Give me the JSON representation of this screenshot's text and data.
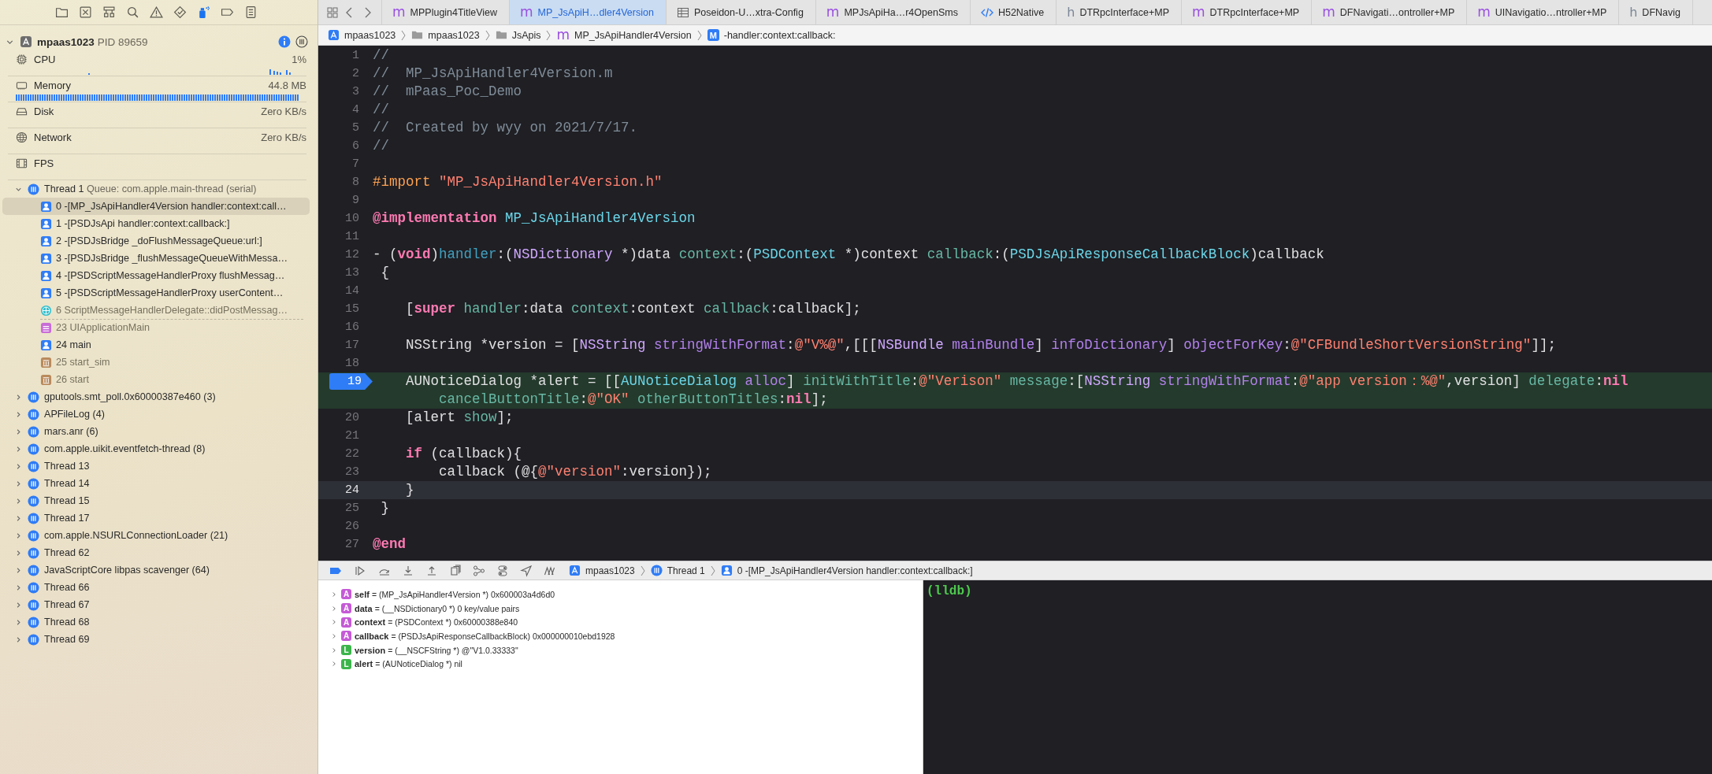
{
  "navigator": [
    {
      "selected": false
    },
    {
      "selected": false
    },
    {
      "selected": false
    },
    {
      "selected": false
    },
    {
      "selected": false
    },
    {
      "selected": false
    },
    {
      "selected": true
    },
    {
      "selected": false
    },
    {
      "selected": false
    }
  ],
  "process": {
    "name": "mpaas1023",
    "pid": "PID 89659"
  },
  "gauges": [
    {
      "kind": "cpu",
      "label": "CPU",
      "value": "1%"
    },
    {
      "kind": "memory",
      "label": "Memory",
      "value": "44.8 MB"
    },
    {
      "kind": "disk",
      "label": "Disk",
      "value": "Zero KB/s"
    },
    {
      "kind": "network",
      "label": "Network",
      "value": "Zero KB/s"
    },
    {
      "kind": "fps",
      "label": "FPS"
    }
  ],
  "threads": [
    {
      "name": "Thread 1",
      "queue": "Queue: com.apple.main-thread (serial)",
      "expanded": true,
      "selected": false,
      "children": [
        {
          "text": "0 -[MP_JsApiHandler4Version handler:context:call…",
          "kind": "user",
          "selected": true,
          "gap_before": false
        },
        {
          "text": "1 -[PSDJsApi handler:context:callback:]",
          "kind": "user",
          "selected": false,
          "gap_before": false
        },
        {
          "text": "2 -[PSDJsBridge _doFlushMessageQueue:url:]",
          "kind": "user",
          "selected": false,
          "gap_before": false
        },
        {
          "text": "3 -[PSDJsBridge _flushMessageQueueWithMessa…",
          "kind": "user",
          "selected": false,
          "gap_before": false
        },
        {
          "text": "4 -[PSDScriptMessageHandlerProxy flushMessag…",
          "kind": "user",
          "selected": false,
          "gap_before": false
        },
        {
          "text": "5 -[PSDScriptMessageHandlerProxy userContent…",
          "kind": "user",
          "selected": false,
          "gap_before": false
        },
        {
          "text": "6 ScriptMessageHandlerDelegate::didPostMessag…",
          "kind": "web",
          "selected": false,
          "gap_before": false
        },
        {
          "text": "23 UIApplicationMain",
          "kind": "uikit",
          "selected": false,
          "gap_before": true
        },
        {
          "text": "24 main",
          "kind": "user",
          "selected": false,
          "gap_before": false
        },
        {
          "text": "25 start_sim",
          "kind": "dyld",
          "selected": false,
          "gap_before": false
        },
        {
          "text": "26 start",
          "kind": "dyld",
          "selected": false,
          "gap_before": false
        }
      ]
    },
    {
      "name": "gputools.smt_poll.0x60000387e460 (3)",
      "expanded": false,
      "selected": false
    },
    {
      "name": "APFileLog (4)",
      "expanded": false,
      "selected": false
    },
    {
      "name": "mars.anr (6)",
      "expanded": false,
      "selected": false
    },
    {
      "name": "com.apple.uikit.eventfetch-thread (8)",
      "expanded": false,
      "selected": false
    },
    {
      "name": "Thread 13",
      "expanded": false,
      "selected": false
    },
    {
      "name": "Thread 14",
      "expanded": false,
      "selected": false
    },
    {
      "name": "Thread 15",
      "expanded": false,
      "selected": false
    },
    {
      "name": "Thread 17",
      "expanded": false,
      "selected": false
    },
    {
      "name": "com.apple.NSURLConnectionLoader (21)",
      "expanded": false,
      "selected": false
    },
    {
      "name": "Thread 62",
      "expanded": false,
      "selected": false
    },
    {
      "name": "JavaScriptCore libpas scavenger (64)",
      "expanded": false,
      "selected": false
    },
    {
      "name": "Thread 66",
      "expanded": false,
      "selected": false
    },
    {
      "name": "Thread 67",
      "expanded": false,
      "selected": false
    },
    {
      "name": "Thread 68",
      "expanded": false,
      "selected": false
    },
    {
      "name": "Thread 69",
      "expanded": false,
      "selected": false
    }
  ],
  "tabs": [
    {
      "kind": "source",
      "badge": "m",
      "label": "MPPlugin4TitleView",
      "selected": false
    },
    {
      "kind": "source",
      "badge": "m",
      "label": "MP_JsApiH…dler4Version",
      "selected": true
    },
    {
      "kind": "plist",
      "label": "Poseidon-U…xtra-Config",
      "selected": false
    },
    {
      "kind": "source",
      "badge": "m",
      "label": "MPJsApiHa…r4OpenSms",
      "selected": false
    },
    {
      "kind": "html",
      "label": "H52Native",
      "selected": false
    },
    {
      "kind": "header",
      "badge": "h",
      "label": "DTRpcInterface+MP",
      "selected": false
    },
    {
      "kind": "source",
      "badge": "m",
      "label": "DTRpcInterface+MP",
      "selected": false
    },
    {
      "kind": "source",
      "badge": "m",
      "label": "DFNavigati…ontroller+MP",
      "selected": false
    },
    {
      "kind": "source",
      "badge": "m",
      "label": "UINavigatio…ntroller+MP",
      "selected": false
    },
    {
      "kind": "header",
      "badge": "h",
      "label": "DFNavig",
      "selected": false
    }
  ],
  "jump_bar": [
    {
      "kind": "app",
      "label": "mpaas1023"
    },
    {
      "kind": "folder",
      "label": "mpaas1023"
    },
    {
      "kind": "folder",
      "label": "JsApis"
    },
    {
      "kind": "source",
      "badge": "m",
      "label": "MP_JsApiHandler4Version"
    },
    {
      "kind": "method",
      "badge": "M",
      "label": "-handler:context:callback:"
    }
  ],
  "editor": {
    "lines": [
      {
        "number": "1",
        "breakpoint": false,
        "executing": false,
        "selected": false,
        "tokens": [
          {
            "kind": "comment",
            "text": "//"
          }
        ]
      },
      {
        "number": "2",
        "breakpoint": false,
        "executing": false,
        "selected": false,
        "tokens": [
          {
            "kind": "comment",
            "text": "//  MP_JsApiHandler4Version.m"
          }
        ]
      },
      {
        "number": "3",
        "breakpoint": false,
        "executing": false,
        "selected": false,
        "tokens": [
          {
            "kind": "comment",
            "text": "//  mPaas_Poc_Demo"
          }
        ]
      },
      {
        "number": "4",
        "breakpoint": false,
        "executing": false,
        "selected": false,
        "tokens": [
          {
            "kind": "comment",
            "text": "//"
          }
        ]
      },
      {
        "number": "5",
        "breakpoint": false,
        "executing": false,
        "selected": false,
        "tokens": [
          {
            "kind": "comment",
            "text": "//  Created by wyy on 2021/7/17."
          }
        ]
      },
      {
        "number": "6",
        "breakpoint": false,
        "executing": false,
        "selected": false,
        "tokens": [
          {
            "kind": "comment",
            "text": "//"
          }
        ]
      },
      {
        "number": "7",
        "breakpoint": false,
        "executing": false,
        "selected": false
      },
      {
        "number": "8",
        "breakpoint": false,
        "executing": false,
        "selected": false,
        "tokens": [
          {
            "kind": "preproc",
            "text": "#import "
          },
          {
            "kind": "string",
            "text": "\"MP_JsApiHandler4Version.h\""
          }
        ]
      },
      {
        "number": "9",
        "breakpoint": false,
        "executing": false,
        "selected": false
      },
      {
        "number": "10",
        "breakpoint": false,
        "executing": false,
        "selected": false,
        "tokens": [
          {
            "kind": "keyword",
            "text": "@implementation "
          },
          {
            "kind": "projclass",
            "text": "MP_JsApiHandler4Version"
          }
        ]
      },
      {
        "number": "11",
        "breakpoint": false,
        "executing": false,
        "selected": false
      },
      {
        "number": "12",
        "breakpoint": false,
        "executing": false,
        "selected": false,
        "tokens": [
          {
            "kind": "plain",
            "text": "- ("
          },
          {
            "kind": "keyword",
            "text": "void"
          },
          {
            "kind": "plain",
            "text": ")"
          },
          {
            "kind": "declaration",
            "text": "handler"
          },
          {
            "kind": "plain",
            "text": ":("
          },
          {
            "kind": "sysclass",
            "text": "NSDictionary"
          },
          {
            "kind": "plain",
            "text": " *)data "
          },
          {
            "kind": "projmethod",
            "text": "context"
          },
          {
            "kind": "plain",
            "text": ":("
          },
          {
            "kind": "projclass",
            "text": "PSDContext"
          },
          {
            "kind": "plain",
            "text": " *)context "
          },
          {
            "kind": "projmethod",
            "text": "callback"
          },
          {
            "kind": "plain",
            "text": ":("
          },
          {
            "kind": "projclass",
            "text": "PSDJsApiResponseCallbackBlock"
          },
          {
            "kind": "plain",
            "text": ")callback"
          }
        ]
      },
      {
        "number": "13",
        "breakpoint": false,
        "executing": false,
        "selected": false,
        "tokens": [
          {
            "kind": "plain",
            "text": " {"
          }
        ]
      },
      {
        "number": "14",
        "breakpoint": false,
        "executing": false,
        "selected": false
      },
      {
        "number": "15",
        "breakpoint": false,
        "executing": false,
        "selected": false,
        "tokens": [
          {
            "kind": "plain",
            "text": "    ["
          },
          {
            "kind": "keyword",
            "text": "super "
          },
          {
            "kind": "projmethod",
            "text": "handler"
          },
          {
            "kind": "plain",
            "text": ":data "
          },
          {
            "kind": "projmethod",
            "text": "context"
          },
          {
            "kind": "plain",
            "text": ":context "
          },
          {
            "kind": "projmethod",
            "text": "callback"
          },
          {
            "kind": "plain",
            "text": ":callback];"
          }
        ]
      },
      {
        "number": "16",
        "breakpoint": false,
        "executing": false,
        "selected": false
      },
      {
        "number": "17",
        "breakpoint": false,
        "executing": false,
        "selected": false,
        "tokens": [
          {
            "kind": "plain",
            "text": "    NSString *version = ["
          },
          {
            "kind": "sysclass",
            "text": "NSString "
          },
          {
            "kind": "sysmethod",
            "text": "stringWithFormat"
          },
          {
            "kind": "plain",
            "text": ":"
          },
          {
            "kind": "string",
            "text": "@\"V%@\""
          },
          {
            "kind": "plain",
            "text": ",[[["
          },
          {
            "kind": "sysclass",
            "text": "NSBundle "
          },
          {
            "kind": "sysmethod",
            "text": "mainBundle"
          },
          {
            "kind": "plain",
            "text": "] "
          },
          {
            "kind": "sysmethod",
            "text": "infoDictionary"
          },
          {
            "kind": "plain",
            "text": "] "
          },
          {
            "kind": "sysmethod",
            "text": "objectForKey"
          },
          {
            "kind": "plain",
            "text": ":"
          },
          {
            "kind": "string",
            "text": "@\"CFBundleShortVersionString\""
          },
          {
            "kind": "plain",
            "text": "]];"
          }
        ]
      },
      {
        "number": "18",
        "breakpoint": false,
        "executing": false,
        "selected": false
      },
      {
        "number": "19",
        "breakpoint": true,
        "executing": true,
        "selected": false,
        "tokens": [
          {
            "kind": "plain",
            "text": "    AUNoticeDialog *alert = [["
          },
          {
            "kind": "projclass",
            "text": "AUNoticeDialog "
          },
          {
            "kind": "sysmethod",
            "text": "alloc"
          },
          {
            "kind": "plain",
            "text": "] "
          },
          {
            "kind": "projmethod",
            "text": "initWithTitle"
          },
          {
            "kind": "plain",
            "text": ":"
          },
          {
            "kind": "string",
            "text": "@\"Verison\""
          },
          {
            "kind": "projmethod",
            "text": " message"
          },
          {
            "kind": "plain",
            "text": ":["
          },
          {
            "kind": "sysclass",
            "text": "NSString "
          },
          {
            "kind": "sysmethod",
            "text": "stringWithFormat"
          },
          {
            "kind": "plain",
            "text": ":"
          },
          {
            "kind": "string",
            "text": "@\"app version：%@\""
          },
          {
            "kind": "plain",
            "text": ",version] "
          },
          {
            "kind": "projmethod",
            "text": "delegate"
          },
          {
            "kind": "plain",
            "text": ":"
          },
          {
            "kind": "keyword",
            "text": "nil "
          },
          {
            "kind": "projmethod",
            "text": "cancelButtonTitle"
          },
          {
            "kind": "plain",
            "text": ":"
          },
          {
            "kind": "string",
            "text": "@\"OK\""
          },
          {
            "kind": "projmethod",
            "text": " otherButtonTitles"
          },
          {
            "kind": "plain",
            "text": ":"
          },
          {
            "kind": "keyword",
            "text": "nil"
          },
          {
            "kind": "plain",
            "text": "];"
          }
        ]
      },
      {
        "number": "20",
        "breakpoint": false,
        "executing": false,
        "selected": false,
        "tokens": [
          {
            "kind": "plain",
            "text": "    [alert "
          },
          {
            "kind": "projmethod",
            "text": "show"
          },
          {
            "kind": "plain",
            "text": "];"
          }
        ]
      },
      {
        "number": "21",
        "breakpoint": false,
        "executing": false,
        "selected": false
      },
      {
        "number": "22",
        "breakpoint": false,
        "executing": false,
        "selected": false,
        "tokens": [
          {
            "kind": "keyword",
            "text": "    if"
          },
          {
            "kind": "plain",
            "text": " (callback){"
          }
        ]
      },
      {
        "number": "23",
        "breakpoint": false,
        "executing": false,
        "selected": false,
        "tokens": [
          {
            "kind": "plain",
            "text": "        callback (@{"
          },
          {
            "kind": "string",
            "text": "@\"version\""
          },
          {
            "kind": "plain",
            "text": ":version});"
          }
        ]
      },
      {
        "number": "24",
        "breakpoint": false,
        "executing": false,
        "selected": true,
        "tokens": [
          {
            "kind": "plain",
            "text": "    }"
          }
        ]
      },
      {
        "number": "25",
        "breakpoint": false,
        "executing": false,
        "selected": false,
        "tokens": [
          {
            "kind": "plain",
            "text": " }"
          }
        ]
      },
      {
        "number": "26",
        "breakpoint": false,
        "executing": false,
        "selected": false
      },
      {
        "number": "27",
        "breakpoint": false,
        "executing": false,
        "selected": false,
        "tokens": [
          {
            "kind": "keyword",
            "text": "@end"
          }
        ]
      }
    ]
  },
  "debug_bar": {
    "breakpoints_active": true,
    "path": [
      {
        "kind": "app",
        "label": "mpaas1023"
      },
      {
        "kind": "thread",
        "label": "Thread 1"
      },
      {
        "kind": "frame",
        "label": "0 -[MP_JsApiHandler4Version handler:context:callback:]"
      }
    ]
  },
  "variables": [
    {
      "kind": "argument",
      "badge": "A",
      "name": "self",
      "description": "= (MP_JsApiHandler4Version *) 0x600003a4d6d0"
    },
    {
      "kind": "argument",
      "badge": "A",
      "name": "data",
      "description": "= (__NSDictionary0 *) 0 key/value pairs"
    },
    {
      "kind": "argument",
      "badge": "A",
      "name": "context",
      "description": "= (PSDContext *) 0x60000388e840"
    },
    {
      "kind": "argument",
      "badge": "A",
      "name": "callback",
      "description": "= (PSDJsApiResponseCallbackBlock) 0x000000010ebd1928"
    },
    {
      "kind": "local",
      "badge": "L",
      "name": "version",
      "description": "= (__NSCFString *) @\"V1.0.33333\""
    },
    {
      "kind": "local",
      "badge": "L",
      "name": "alert",
      "description": "= (AUNoticeDialog *) nil"
    }
  ],
  "console": {
    "text": "(lldb)"
  }
}
